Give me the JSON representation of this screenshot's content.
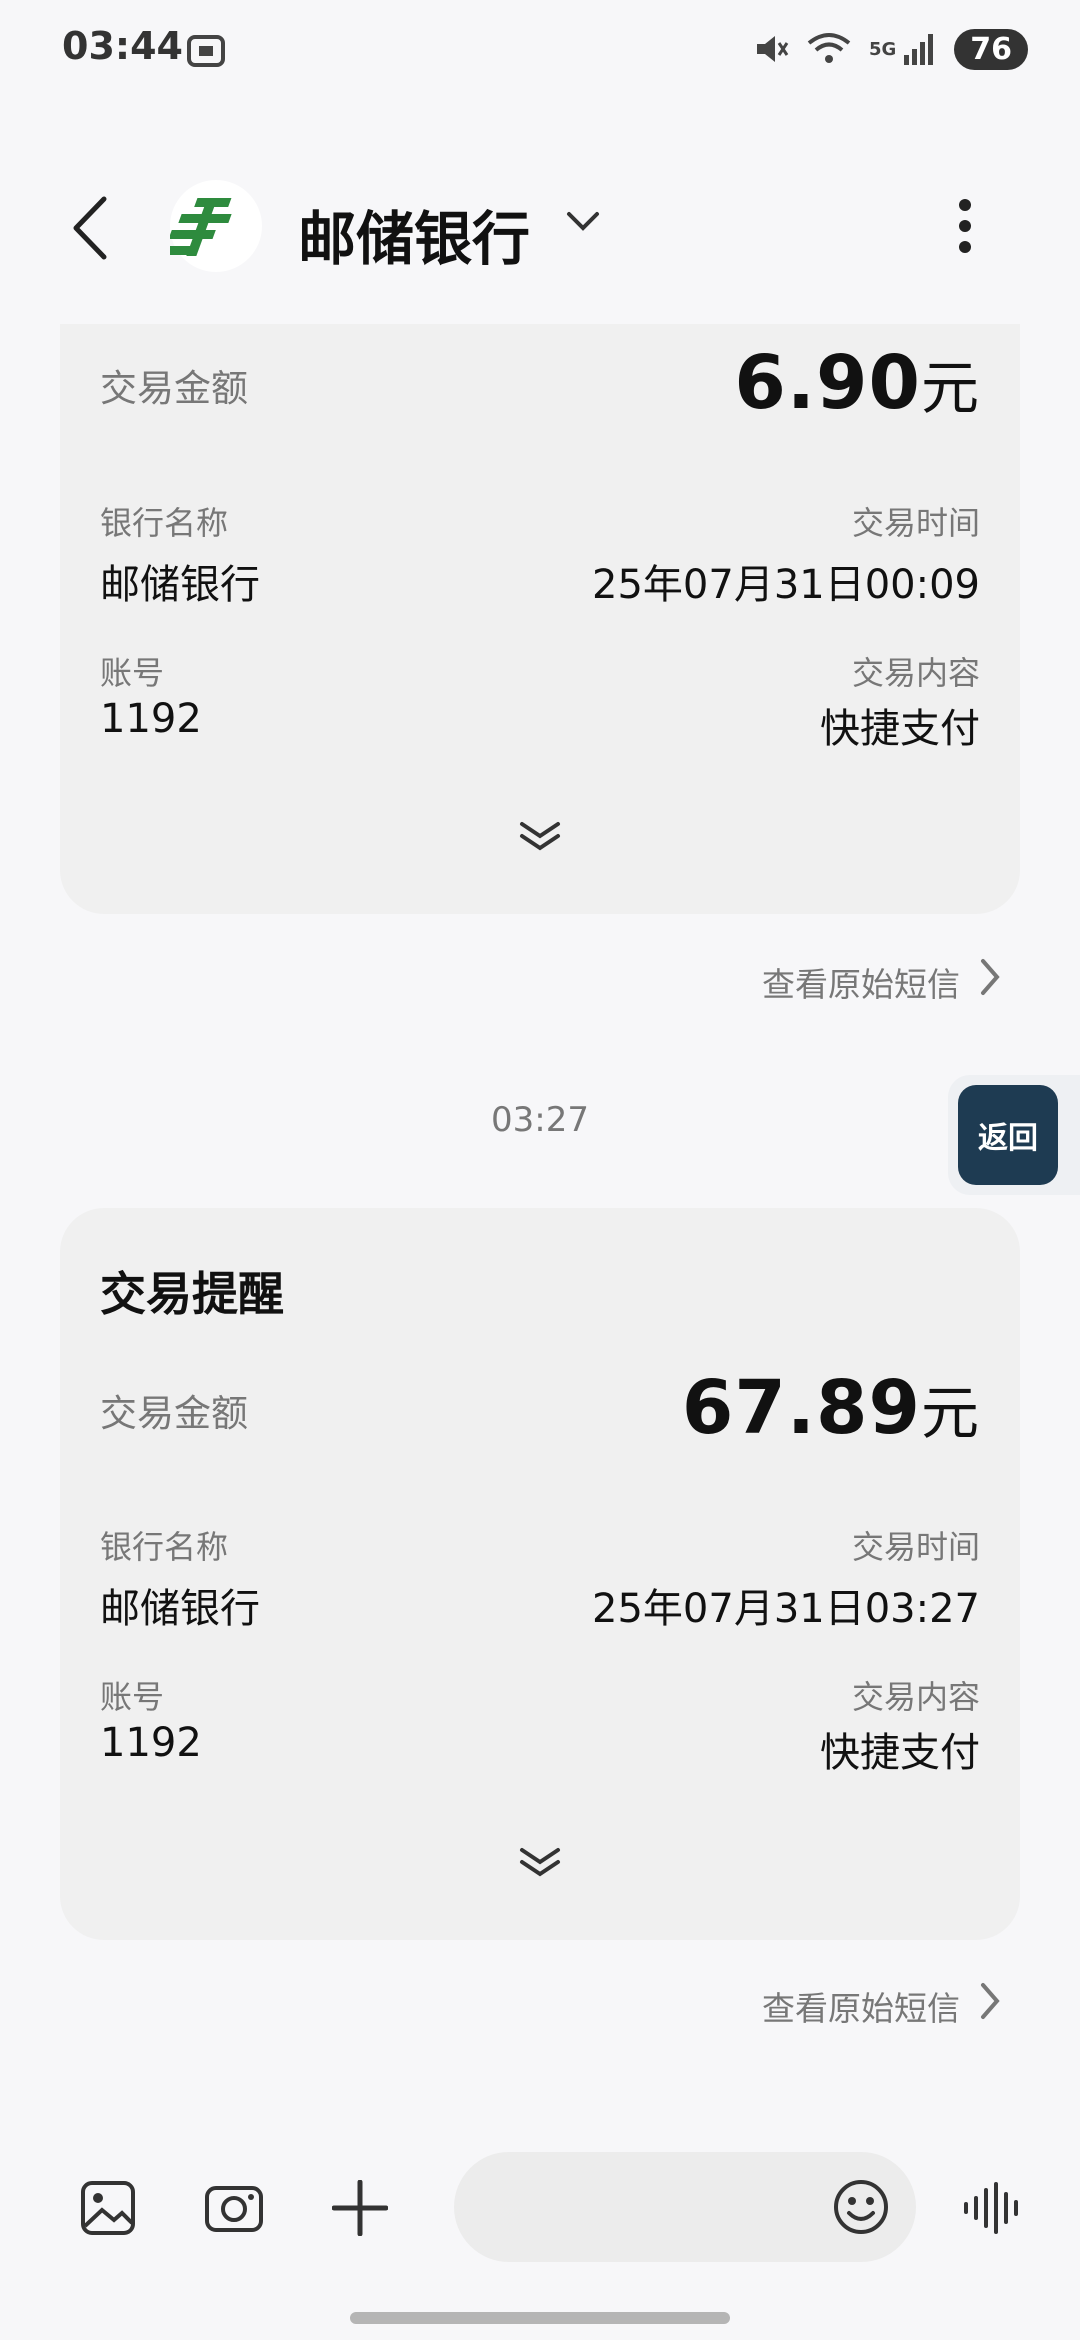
{
  "status_bar": {
    "time": "03:44",
    "icons": [
      "screenshot-icon",
      "mute-icon",
      "wifi-icon",
      "signal-icon"
    ],
    "network": "5G",
    "battery": "76"
  },
  "header": {
    "title": "邮储银行",
    "logo_icon": "postal-bank-logo-icon"
  },
  "cards": [
    {
      "amount_label": "交易金额",
      "amount_number": "6.90",
      "amount_unit": "元",
      "bank_label": "银行名称",
      "bank_value": "邮储银行",
      "time_label": "交易时间",
      "time_value": "25年07月31日00:09",
      "account_label": "账号",
      "account_value": "1192",
      "content_label": "交易内容",
      "content_value": "快捷支付",
      "view_original": "查看原始短信"
    },
    {
      "heading": "交易提醒",
      "amount_label": "交易金额",
      "amount_number": "67.89",
      "amount_unit": "元",
      "bank_label": "银行名称",
      "bank_value": "邮储银行",
      "time_label": "交易时间",
      "time_value": "25年07月31日03:27",
      "account_label": "账号",
      "account_value": "1192",
      "content_label": "交易内容",
      "content_value": "快捷支付",
      "view_original": "查看原始短信"
    }
  ],
  "timestamp": "03:27",
  "floating_button": "返回",
  "colors": {
    "logo_green": "#2e8b3e",
    "card_bg": "#f0f0f0",
    "page_bg": "#f7f7f9"
  }
}
